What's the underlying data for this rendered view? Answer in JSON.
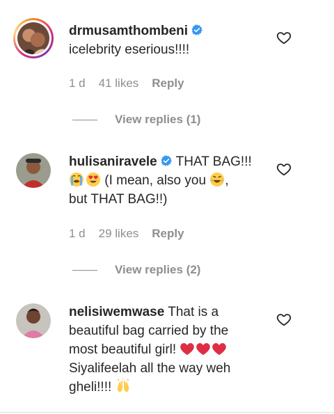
{
  "comments": [
    {
      "username": "drmusamthombeni",
      "verified": true,
      "has_story": true,
      "text": "icelebrity eserious!!!!",
      "time": "1 d",
      "likes": "41 likes",
      "reply_label": "Reply",
      "view_replies": "View replies (1)"
    },
    {
      "username": "hulisaniravele",
      "verified": true,
      "has_story": false,
      "text_part1": "THAT BAG!!!",
      "text_part2": "(I mean, also you",
      "text_part3": ",",
      "text_part4": "but THAT BAG!!)",
      "time": "1 d",
      "likes": "29 likes",
      "reply_label": "Reply",
      "view_replies": "View replies (2)"
    },
    {
      "username": "nelisiwemwase",
      "verified": false,
      "has_story": false,
      "text_part1": "That is a beautiful bag carried by the most beautiful girl!",
      "text_part2": "Siyalifeelah all the way weh gheli!!!!"
    }
  ],
  "colors": {
    "primary_text": "#262626",
    "secondary_text": "#8e8e8e",
    "verified_blue": "#3897f0",
    "heart_red": "#e0245e"
  },
  "icons": {
    "like": "heart-outline-icon",
    "verified": "verified-badge-icon"
  }
}
